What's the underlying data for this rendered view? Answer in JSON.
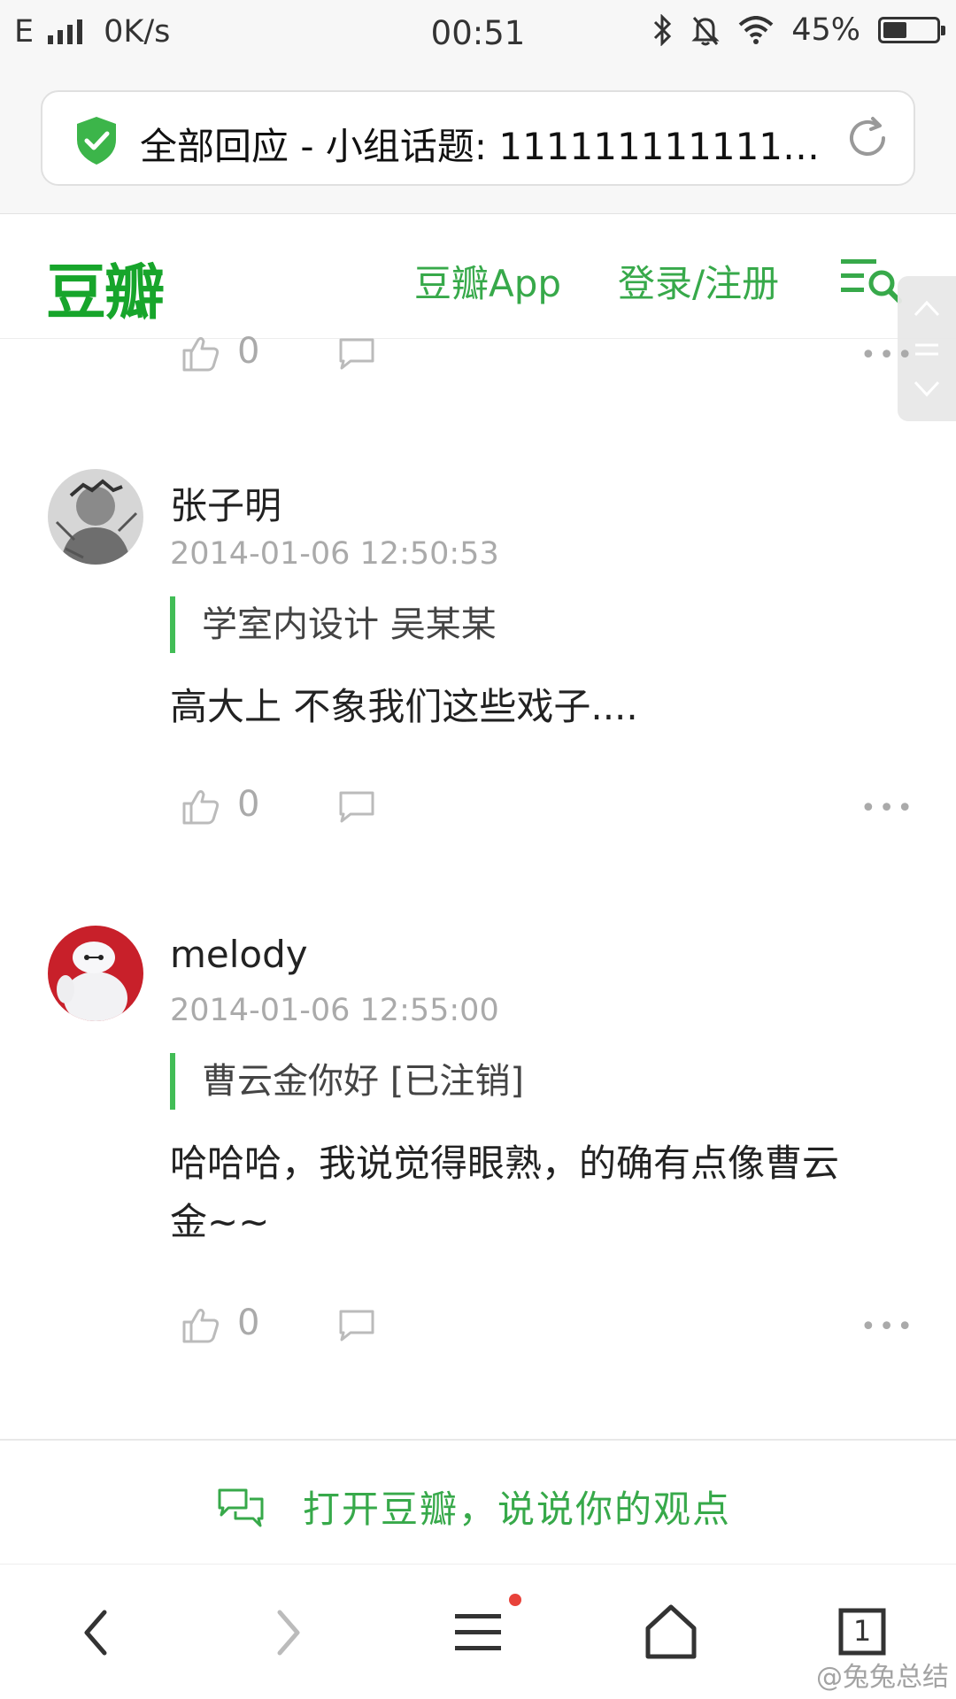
{
  "status_bar": {
    "network": "E",
    "speed": "0K/s",
    "time": "00:51",
    "battery": "45%"
  },
  "address_bar": {
    "title": "全部回应 - 小组话题: 111111111111…",
    "security_icon": "shield-check-icon",
    "reload_icon": "reload-icon"
  },
  "site_header": {
    "logo": "豆瓣",
    "app_link": "豆瓣App",
    "login_link": "登录/注册",
    "menu_icon": "menu-search-icon",
    "brand_color": "#17a52b"
  },
  "top_actions": {
    "like_count": "0"
  },
  "comments": [
    {
      "author": "张子明",
      "time": "2014-01-06 12:50:53",
      "quote": "学室内设计 吴某某",
      "text": "高大上 不象我们这些戏子....",
      "like_count": "0"
    },
    {
      "author": "melody",
      "time": "2014-01-06 12:55:00",
      "quote": "曹云金你好 [已注销]",
      "text_line1": "哈哈哈，我说觉得眼熟，的确有点像曹云",
      "text_line2": "金~~",
      "like_count": "0"
    }
  ],
  "cta": {
    "label": "打开豆瓣，说说你的观点"
  },
  "browser_nav": {
    "tab_count": "1"
  },
  "watermark": "@兔兔总结"
}
